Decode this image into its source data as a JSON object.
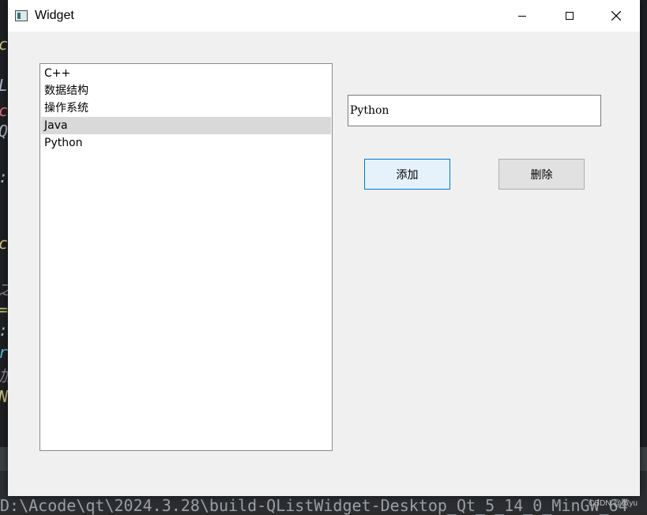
{
  "window": {
    "title": "Widget"
  },
  "list": {
    "items": [
      "C++",
      "数据结构",
      "操作系统",
      "Java",
      "Python"
    ],
    "selected_index": 3
  },
  "input": {
    "value": "Python"
  },
  "buttons": {
    "add_label": "添加",
    "delete_label": "删除"
  },
  "background": {
    "path_text": "D:\\Acode\\qt\\2024.3.28\\build-QListWidget-Desktop_Qt_5_14_0_MinGW_64",
    "watermark": "CSDN @微yu"
  },
  "colors": {
    "accent": "#0078d7",
    "selection": "#d9d9d9",
    "window_bg": "#f0f0f0"
  },
  "icons": {
    "app": "app-window-icon",
    "minimize": "minimize-icon",
    "maximize": "maximize-icon",
    "close": "close-icon"
  }
}
